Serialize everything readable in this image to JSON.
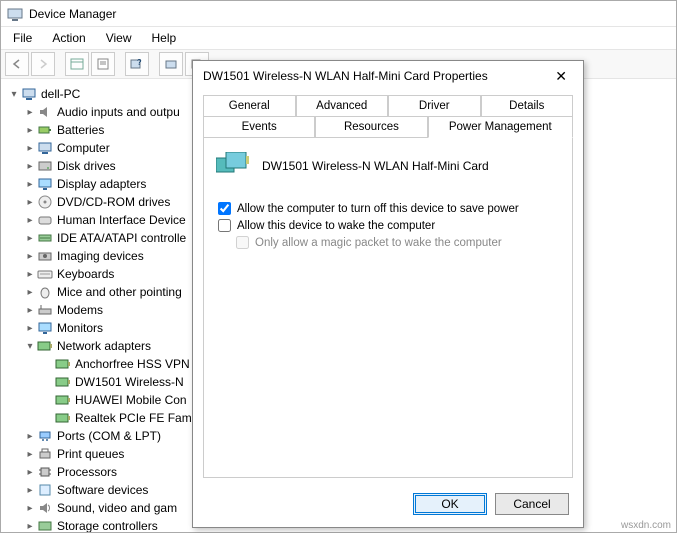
{
  "window": {
    "title": "Device Manager",
    "menu": {
      "file": "File",
      "action": "Action",
      "view": "View",
      "help": "Help"
    }
  },
  "tree": {
    "root": "dell-PC",
    "items": [
      {
        "label": "Audio inputs and outpu"
      },
      {
        "label": "Batteries"
      },
      {
        "label": "Computer"
      },
      {
        "label": "Disk drives"
      },
      {
        "label": "Display adapters"
      },
      {
        "label": "DVD/CD-ROM drives"
      },
      {
        "label": "Human Interface Device"
      },
      {
        "label": "IDE ATA/ATAPI controlle"
      },
      {
        "label": "Imaging devices"
      },
      {
        "label": "Keyboards"
      },
      {
        "label": "Mice and other pointing"
      },
      {
        "label": "Modems"
      },
      {
        "label": "Monitors"
      }
    ],
    "network": {
      "label": "Network adapters",
      "children": [
        "Anchorfree HSS VPN",
        "DW1501 Wireless-N",
        "HUAWEI Mobile Con",
        "Realtek PCIe FE Fam"
      ]
    },
    "after": [
      {
        "label": "Ports (COM & LPT)"
      },
      {
        "label": "Print queues"
      },
      {
        "label": "Processors"
      },
      {
        "label": "Software devices"
      },
      {
        "label": "Sound, video and gam"
      },
      {
        "label": "Storage controllers"
      }
    ]
  },
  "dialog": {
    "title": "DW1501 Wireless-N WLAN Half-Mini Card Properties",
    "tabs": {
      "general": "General",
      "advanced": "Advanced",
      "driver": "Driver",
      "details": "Details",
      "events": "Events",
      "resources": "Resources",
      "power": "Power Management"
    },
    "device_name": "DW1501 Wireless-N WLAN Half-Mini Card",
    "chk_turnoff": "Allow the computer to turn off this device to save power",
    "chk_wake": "Allow this device to wake the computer",
    "chk_magic": "Only allow a magic packet to wake the computer",
    "ok": "OK",
    "cancel": "Cancel"
  },
  "watermark": "wsxdn.com"
}
